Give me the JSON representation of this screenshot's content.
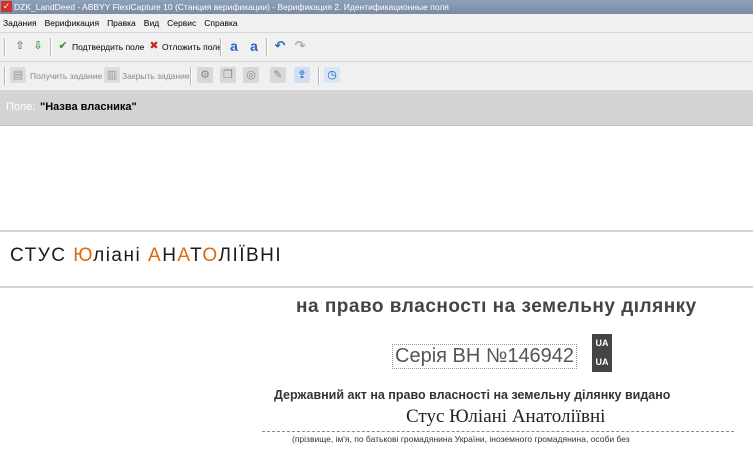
{
  "window": {
    "title": "DZK_LandDeed - ABBYY FlexiCapture 10 (Станция верификации) - Верификация 2. Идентификационные поля"
  },
  "menu": [
    "Задания",
    "Верификация",
    "Правка",
    "Вид",
    "Сервис",
    "Справка"
  ],
  "toolbar1": {
    "confirm_label": "Подтвердить поле",
    "postpone_label": "Отложить поле"
  },
  "toolbar2": {
    "get_task_label": "Получить задание",
    "close_task_label": "Закрыть задание"
  },
  "field": {
    "caption": "Поле:",
    "value": "\"Назва власника\""
  },
  "entry": {
    "parts": [
      {
        "text": "СТУС ",
        "hl": false
      },
      {
        "text": "Ю",
        "hl": true
      },
      {
        "text": "ліані ",
        "hl": false
      },
      {
        "text": "А",
        "hl": true
      },
      {
        "text": "Н",
        "hl": false
      },
      {
        "text": "А",
        "hl": true
      },
      {
        "text": "Т",
        "hl": false
      },
      {
        "text": "О",
        "hl": true
      },
      {
        "text": "ЛІЇВНІ",
        "hl": false
      }
    ]
  },
  "document": {
    "heading": "на право власності на земельну ділянку",
    "series": "Серія ВН №146942",
    "stamp_top": "UA",
    "stamp_bottom": "UA",
    "line2": "Державний акт на право власності на земельну ділянку видано",
    "name": "Стус Юліані Анатоліївні",
    "footnote": "(прізвище, ім'я, по батькові громадянина України, іноземного громадянина, особи без"
  },
  "colors": {
    "highlight": "#e06a0a",
    "field_bar": "#d4d4d4",
    "title_bar": "#7a8ca5"
  }
}
